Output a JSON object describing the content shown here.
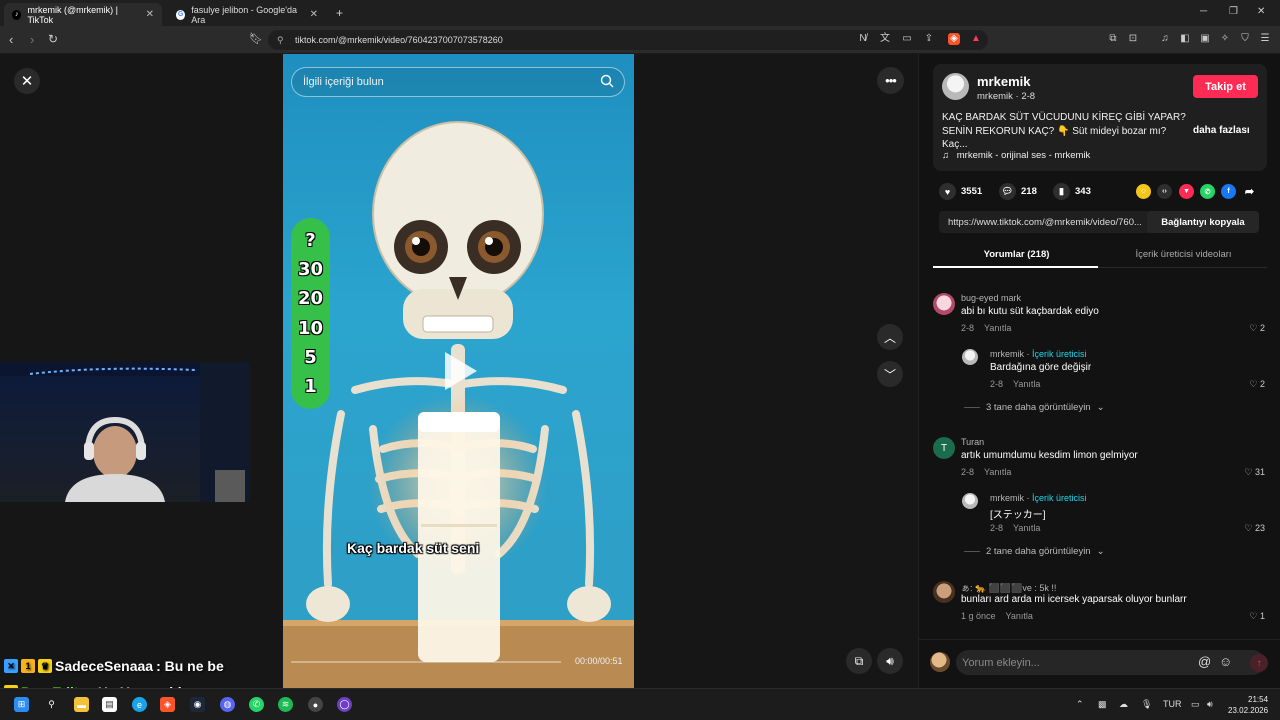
{
  "browser": {
    "tabs": [
      {
        "label": "mrkemik (@mrkemik) | TikTok",
        "active": true
      },
      {
        "label": "fasulye jelibon - Google'da Ara",
        "active": false
      }
    ],
    "new_tab": "+",
    "url": "tiktok.com/@mrkemik/video/7604237007073578260"
  },
  "video": {
    "search_placeholder": "İlgili içeriği bulun",
    "green_bar": [
      "?",
      "30",
      "20",
      "10",
      "5",
      "1"
    ],
    "caption": "Kaç bardak süt seni",
    "timecode": "00:00/00:51",
    "progress": 0
  },
  "chat": [
    {
      "user": "SadeceSenaaa",
      "message": ": Bu ne be",
      "user_color": "#ffffff"
    },
    {
      "user": "PoyrEdits",
      "message": ": Hg Yengeabla",
      "user_color": "#7cff3a"
    }
  ],
  "post": {
    "author": "mrkemik",
    "handle": "mrkemik · 2-8",
    "follow_label": "Takip et",
    "description": "KAÇ BARDAK SÜT VÜCUDUNU KİREÇ GİBİ YAPAR? SENİN REKORUN KAÇ? 👇 Süt mideyi bozar mı? Kaç...",
    "more_label": "daha fazlası",
    "music": "mrkemik - orijinal ses - mrkemik",
    "likes": "3551",
    "comments": "218",
    "saves": "343",
    "link": "https://www.tiktok.com/@mrkemik/video/760...",
    "copy_label": "Bağlantıyı kopyala"
  },
  "panel_tabs": [
    "Yorumlar (218)",
    "İçerik üreticisi videoları"
  ],
  "comments": [
    {
      "user": "bug-eyed mark",
      "text": "abi bı kutu süt kaçbardak ediyo",
      "date": "2-8",
      "reply": "Yanıtla",
      "likes": "2"
    },
    {
      "user": "mrkemik",
      "creator_tag": "İçerik üreticisi",
      "text": "Bardağına göre değişir",
      "date": "2-8",
      "reply": "Yanıtla",
      "likes": "2"
    },
    {
      "view_more": "3 tane daha görüntüleyin"
    },
    {
      "user": "Turan",
      "text": "artık umumdumu kesdim limon gelmiyor",
      "date": "2-8",
      "reply": "Yanıtla",
      "likes": "31"
    },
    {
      "user": "mrkemik",
      "creator_tag": "İçerik üreticisi",
      "text": "[ステッカー]",
      "date": "2-8",
      "reply": "Yanıtla",
      "likes": "23"
    },
    {
      "view_more": "2 tane daha görüntüleyin"
    },
    {
      "user": "ぁ: 🐆 ⬛⬛⬛ve : 5k !!",
      "text": "bunları ard arda mi icersek yaparsak oluyor bunlarr",
      "date": "1 g önce",
      "reply": "Yanıtla",
      "likes": "1"
    }
  ],
  "comment_input": {
    "placeholder": "Yorum ekleyin..."
  },
  "taskbar": {
    "lang": "TUR",
    "time": "21:54",
    "date": "23.02.2026"
  }
}
